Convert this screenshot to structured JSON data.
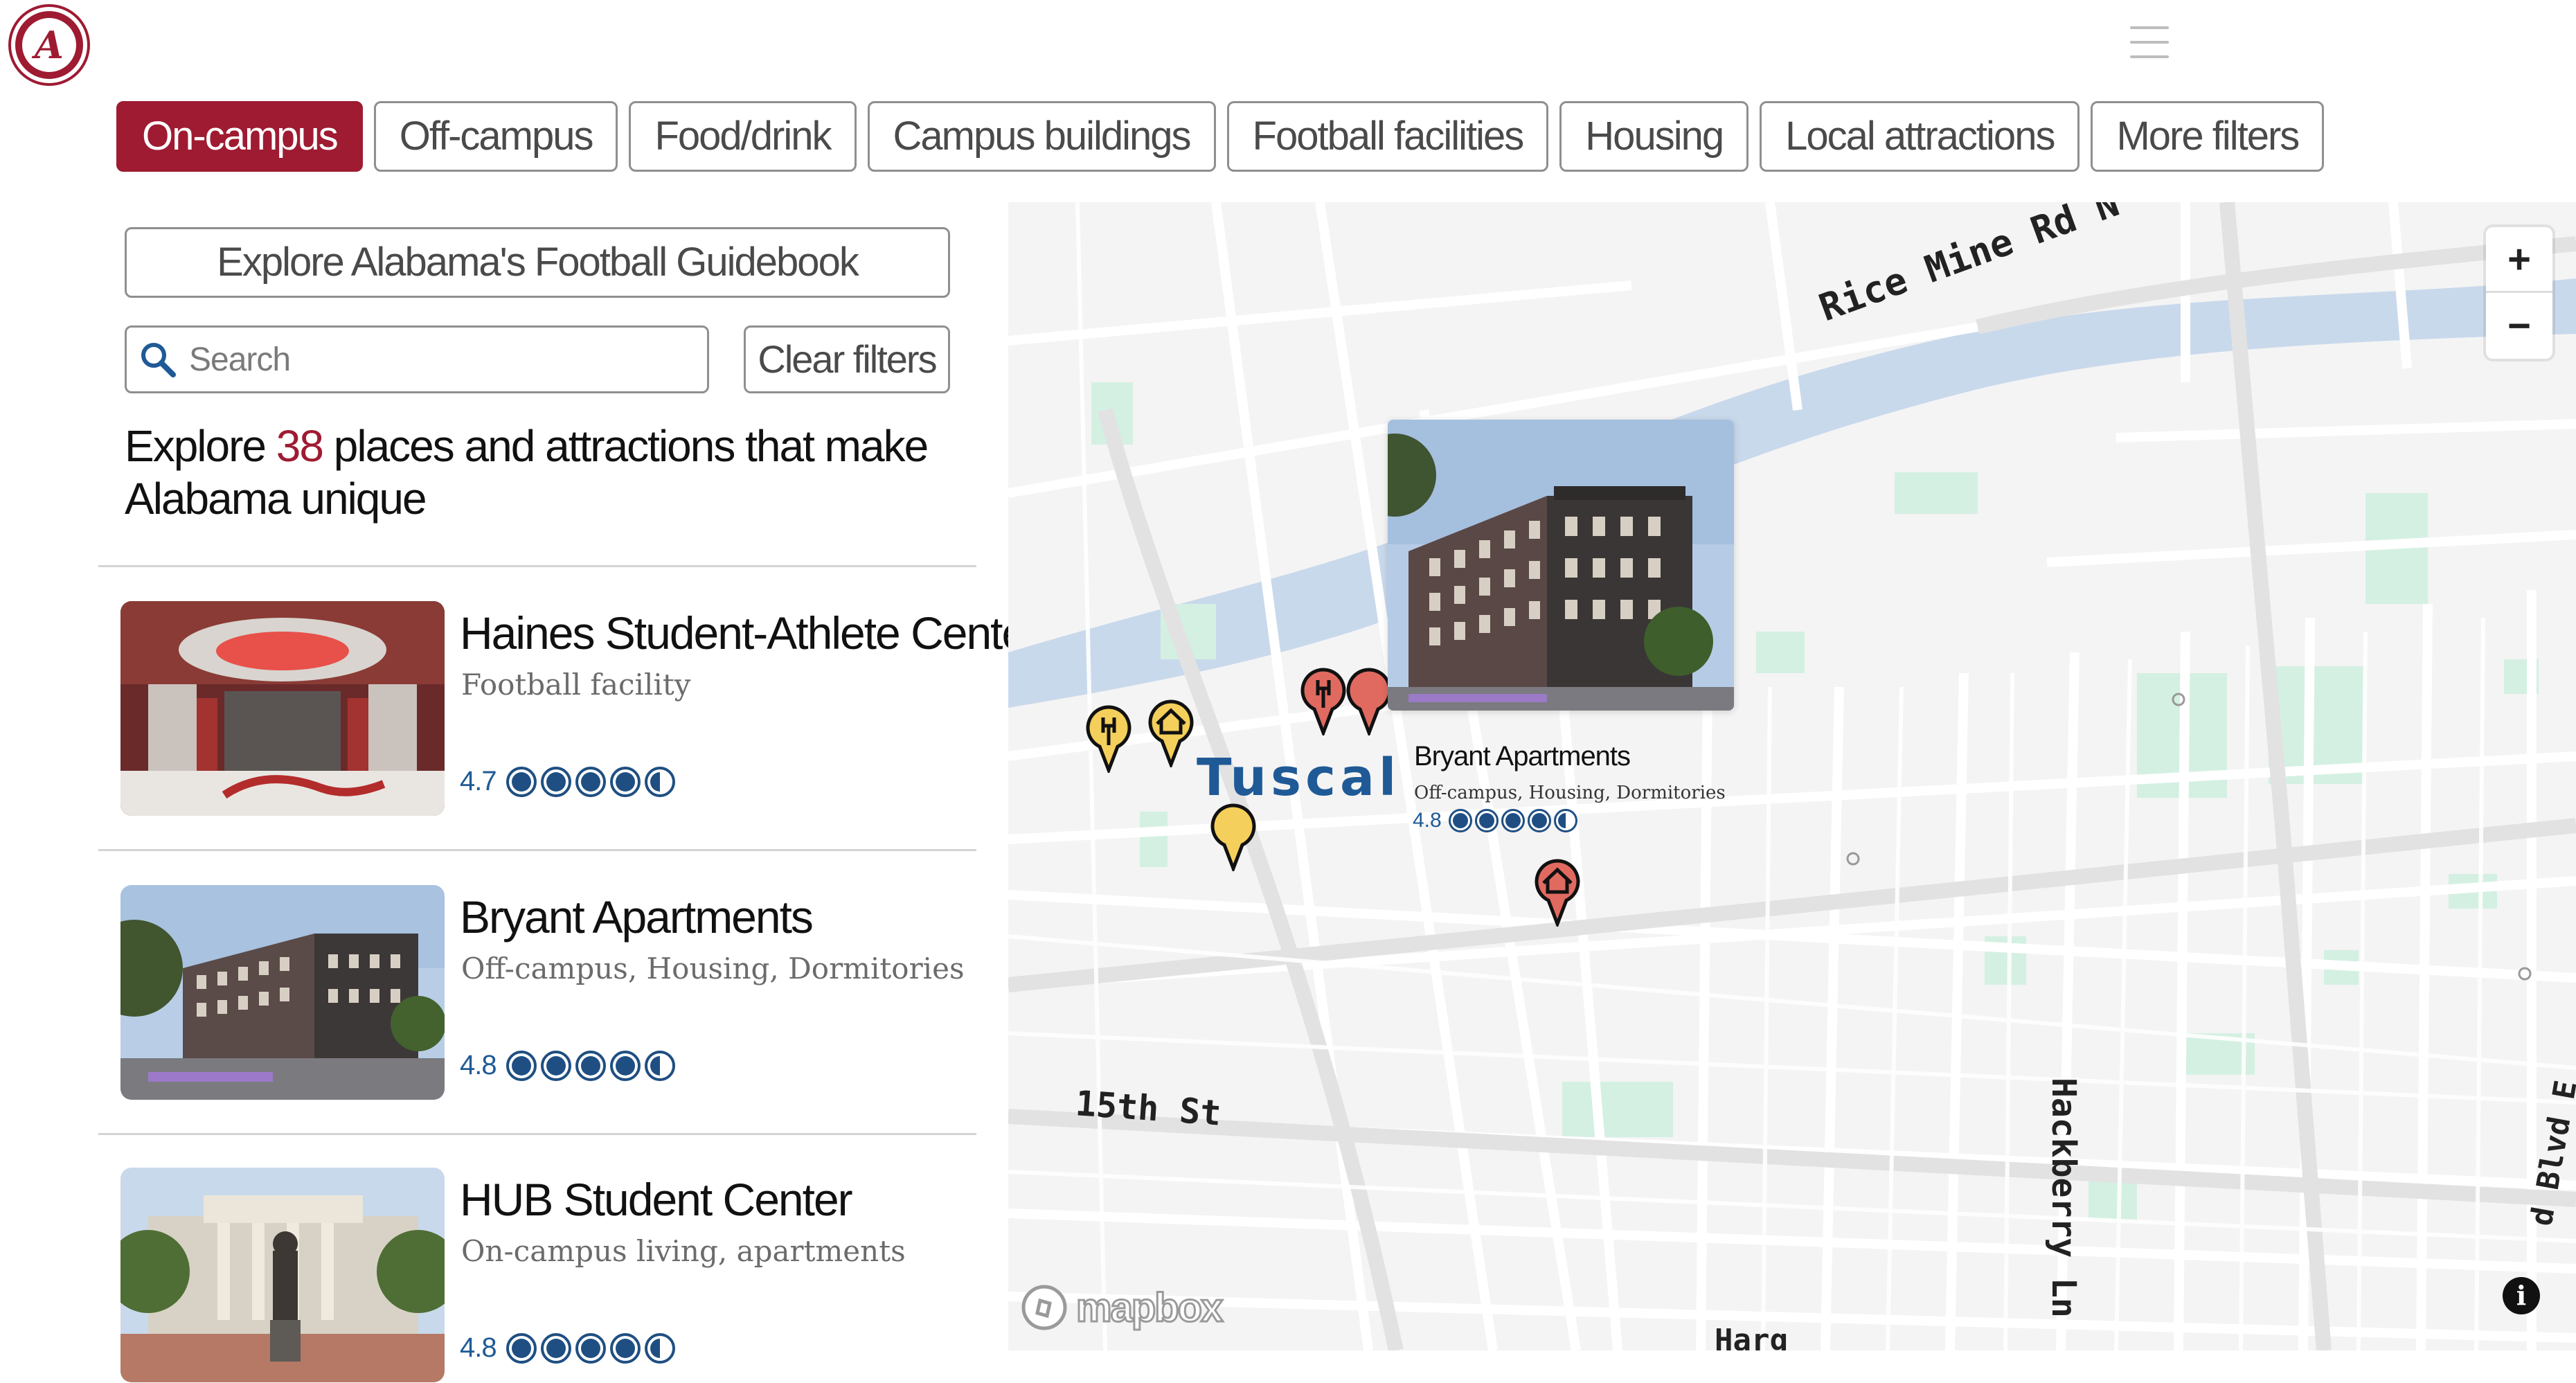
{
  "brand": {
    "logo_letter": "A"
  },
  "filters": [
    {
      "label": "On-campus",
      "active": true
    },
    {
      "label": "Off-campus",
      "active": false
    },
    {
      "label": "Food/drink",
      "active": false
    },
    {
      "label": "Campus buildings",
      "active": false
    },
    {
      "label": "Football facilities",
      "active": false
    },
    {
      "label": "Housing",
      "active": false
    },
    {
      "label": "Local attractions",
      "active": false
    },
    {
      "label": "More filters",
      "active": false
    }
  ],
  "guidebook_button": "Explore Alabama's Football Guidebook",
  "search": {
    "placeholder": "Search"
  },
  "clear_filters": "Clear filters",
  "headline": {
    "prefix": "Explore",
    "count": "38",
    "suffix": "places and attractions that make Alabama unique"
  },
  "places": [
    {
      "title": "Haines Student-Athlete Center",
      "subtitle": "Football facility",
      "rating": "4.7",
      "rating_value": 4.7
    },
    {
      "title": "Bryant Apartments",
      "subtitle": "Off-campus, Housing, Dormitories",
      "rating": "4.8",
      "rating_value": 4.8
    },
    {
      "title": "HUB Student Center",
      "subtitle": "On-campus living, apartments",
      "rating": "4.8",
      "rating_value": 4.8
    }
  ],
  "map": {
    "labels": {
      "rice_mine": "Rice Mine Rd N",
      "city": "Tuscal",
      "fifteenth": "15th St",
      "hackberry": "Hackberry Ln",
      "harg": "Harg",
      "blvd": "d Blvd E"
    },
    "popup": {
      "title": "Bryant Apartments",
      "subtitle": "Off-campus, Housing, Dormitories",
      "rating": "4.8",
      "rating_value": 4.8
    },
    "zoom_in": "+",
    "zoom_out": "−",
    "attribution": "mapbox",
    "info": "i",
    "colors": {
      "water": "#c9d9ec",
      "park": "#d4f0e2",
      "road": "#ffffff",
      "land": "#f4f4f4"
    }
  },
  "colors": {
    "accent": "#9e1b32",
    "rating": "#1f4f82",
    "pin_yellow": "#f5cf5b",
    "pin_red": "#e06a60"
  }
}
